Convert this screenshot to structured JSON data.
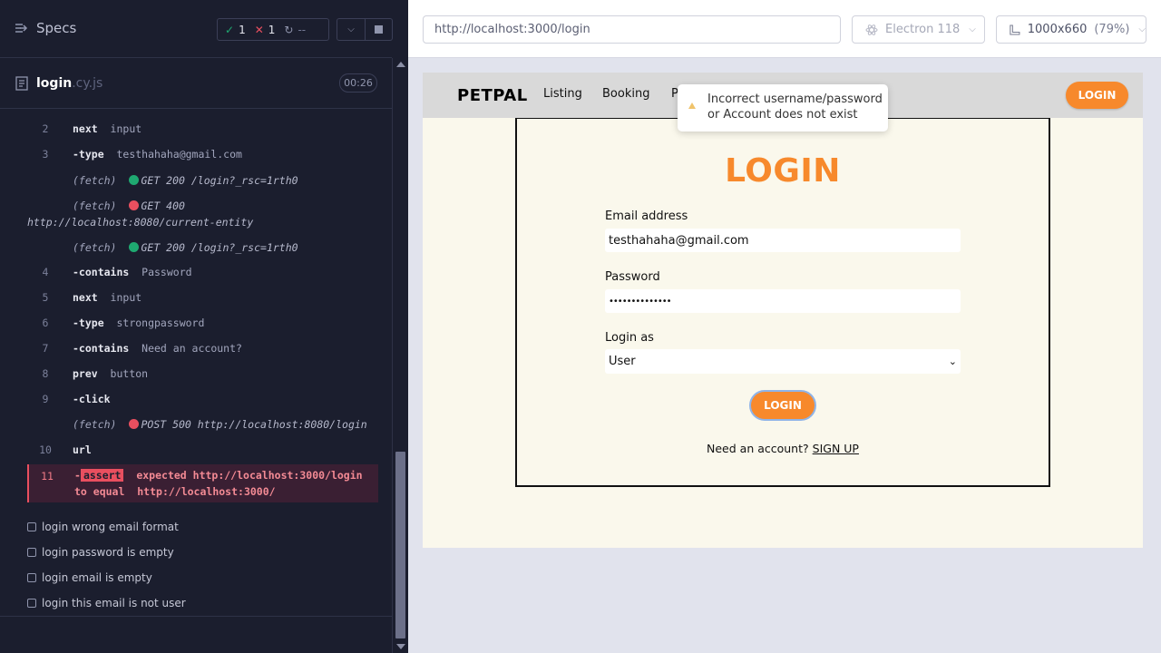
{
  "specs_label": "Specs",
  "stats": {
    "passed": "1",
    "failed": "1",
    "pending": "--"
  },
  "file": {
    "name": "login",
    "ext": ".cy.js",
    "duration": "00:26"
  },
  "commands": [
    {
      "ln": "2",
      "kw": "next",
      "arg": "input"
    },
    {
      "ln": "3",
      "kw": "-type",
      "arg": "testhahaha@gmail.com"
    },
    {
      "fetch": "(fetch)",
      "status": "green",
      "req": "GET 200 /login?_rsc=1rth0"
    },
    {
      "fetch": "(fetch)",
      "status": "red",
      "req": "GET 400",
      "req2": "http://localhost:8080/current-entity"
    },
    {
      "fetch": "(fetch)",
      "status": "green",
      "req": "GET 200 /login?_rsc=1rth0"
    },
    {
      "ln": "4",
      "kw": "-contains",
      "arg": "Password"
    },
    {
      "ln": "5",
      "kw": "next",
      "arg": "input"
    },
    {
      "ln": "6",
      "kw": "-type",
      "arg": "strongpassword"
    },
    {
      "ln": "7",
      "kw": "-contains",
      "arg": "Need an account?"
    },
    {
      "ln": "8",
      "kw": "prev",
      "arg": "button"
    },
    {
      "ln": "9",
      "kw": "-click",
      "arg": ""
    },
    {
      "fetch": "(fetch)",
      "status": "red",
      "req": "POST 500 http://localhost:8080/login"
    },
    {
      "ln": "10",
      "kw": "url",
      "arg": ""
    }
  ],
  "failed_command": {
    "ln": "11",
    "tag": "assert",
    "line1": "expected http://localhost:3000/login",
    "line2_a": "to equal",
    "line2_b": "http://localhost:3000/"
  },
  "tests": [
    "login wrong email format",
    "login password is empty",
    "login email is empty",
    "login this email is not user"
  ],
  "topbar": {
    "url": "http://localhost:3000/login",
    "browser": "Electron 118",
    "viewport": "1000x660",
    "zoom": "(79%)"
  },
  "app": {
    "brand": "PETPAL",
    "nav": [
      "Listing",
      "Booking",
      "P"
    ],
    "nav_login": "LOGIN",
    "toast": "Incorrect username/password or Account does not exist",
    "title": "LOGIN",
    "email_label": "Email address",
    "email_value": "testhahaha@gmail.com",
    "password_label": "Password",
    "password_value": "••••••••••••••",
    "role_label": "Login as",
    "role_value": "User",
    "submit": "LOGIN",
    "signup_prompt": "Need an account?",
    "signup_link": "SIGN UP"
  },
  "colors": {
    "accent": "#f7892c",
    "pass": "#1fa971",
    "fail": "#e94f5f",
    "panel": "#1b1e2e"
  }
}
